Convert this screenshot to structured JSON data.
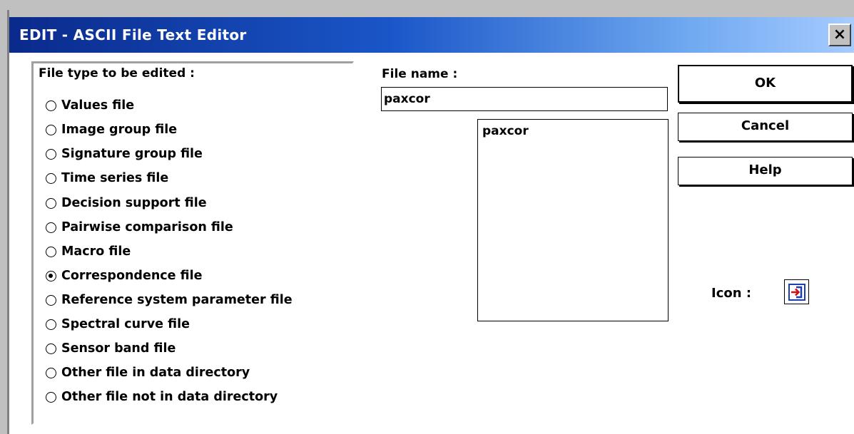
{
  "window": {
    "title": "EDIT - ASCII File Text Editor",
    "close_glyph": "×"
  },
  "file_type_group": {
    "title": "File type to be edited :",
    "options": [
      {
        "label": "Values file",
        "checked": false
      },
      {
        "label": "Image group file",
        "checked": false
      },
      {
        "label": "Signature group file",
        "checked": false
      },
      {
        "label": "Time series file",
        "checked": false
      },
      {
        "label": "Decision support file",
        "checked": false
      },
      {
        "label": "Pairwise comparison file",
        "checked": false
      },
      {
        "label": "Macro file",
        "checked": false
      },
      {
        "label": "Correspondence file",
        "checked": true
      },
      {
        "label": "Reference system parameter file",
        "checked": false
      },
      {
        "label": "Spectral curve file",
        "checked": false
      },
      {
        "label": "Sensor band file",
        "checked": false
      },
      {
        "label": "Other file in data directory",
        "checked": false
      },
      {
        "label": "Other file not in data directory",
        "checked": false
      }
    ]
  },
  "file_name": {
    "label": "File name :",
    "value": "paxcor",
    "list_items": [
      "paxcor"
    ]
  },
  "buttons": {
    "ok": "OK",
    "cancel": "Cancel",
    "help": "Help"
  },
  "icon": {
    "label": "Icon :",
    "name": "import-arrow-icon"
  },
  "colors": {
    "title_bar_start": "#0a2a8c",
    "title_bar_end": "#a6cbff",
    "icon_accent": "#d01010",
    "icon_frame": "#1a3fb0"
  }
}
